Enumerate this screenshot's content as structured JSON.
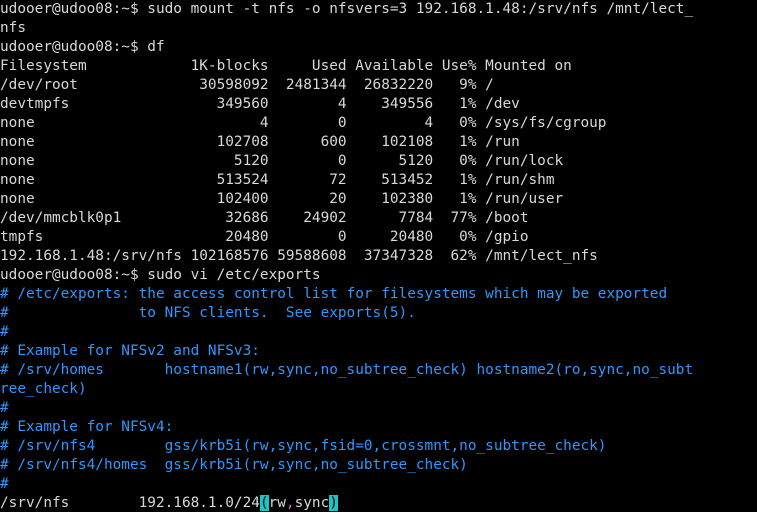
{
  "colors": {
    "background": "#000000",
    "text": "#d8d8d8",
    "comment": "#2f97ff",
    "cursor_highlight": "#17c7c7",
    "option_separator": "#d957d9"
  },
  "terminal": {
    "lines": [
      "udooer@udoo08:~$ sudo mount -t nfs -o nfsvers=3 192.168.1.48:/srv/nfs /mnt/lect_",
      "nfs",
      "udooer@udoo08:~$ df",
      "Filesystem            1K-blocks     Used Available Use% Mounted on",
      "/dev/root              30598092  2481344  26832220   9% /",
      "devtmpfs                 349560        4    349556   1% /dev",
      "none                          4        0         4   0% /sys/fs/cgroup",
      "none                     102708      600    102108   1% /run",
      "none                       5120        0      5120   0% /run/lock",
      "none                     513524       72    513452   1% /run/shm",
      "none                     102400       20    102380   1% /run/user",
      "/dev/mmcblk0p1            32686    24902      7784  77% /boot",
      "tmpfs                     20480        0     20480   0% /gpio",
      "192.168.1.48:/srv/nfs 102168576 59588608  37347328  62% /mnt/lect_nfs",
      "udooer@udoo08:~$ sudo vi /etc/exports",
      "# /etc/exports: the access control list for filesystems which may be exported",
      "#               to NFS clients.  See exports(5).",
      "#",
      "# Example for NFSv2 and NFSv3:",
      "# /srv/homes       hostname1(rw,sync,no_subtree_check) hostname2(ro,sync,no_subt",
      "ree_check)",
      "#",
      "# Example for NFSv4:",
      "# /srv/nfs4        gss/krb5i(rw,sync,fsid=0,crossmnt,no_subtree_check)",
      "# /srv/nfs4/homes  gss/krb5i(rw,sync,no_subtree_check)",
      "#"
    ],
    "last_line": {
      "prefix": "/srv/nfs        192.168.1.0/24",
      "open_paren": "(",
      "opt1": "rw",
      "comma": ",",
      "opt2": "sync",
      "close_paren": ")"
    }
  }
}
